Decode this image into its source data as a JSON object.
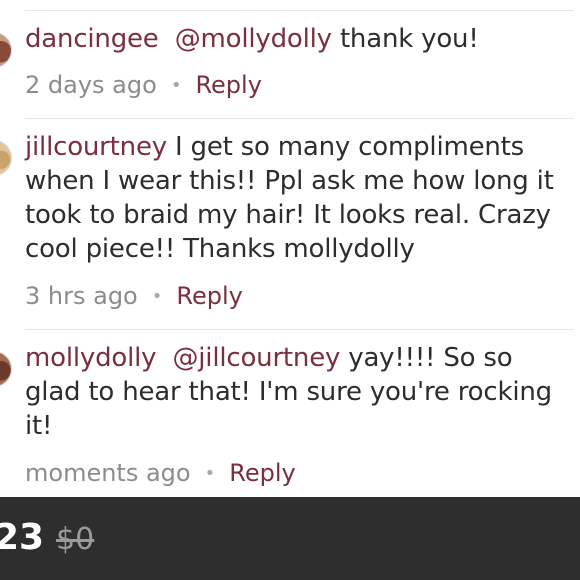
{
  "comments": [
    {
      "username": "dancingee",
      "mention": "@mollydolly",
      "text": " thank you!",
      "time": "2 days ago",
      "reply_label": "Reply"
    },
    {
      "username": "jillcourtney",
      "mention": "",
      "text": " I get so many compliments when I wear this!! Ppl ask me how long it took to braid my hair! It looks real. Crazy cool piece!! Thanks mollydolly",
      "time": "3 hrs ago",
      "reply_label": "Reply"
    },
    {
      "username": "mollydolly",
      "mention": "@jillcourtney",
      "text": " yay!!!! So so glad to hear that! I'm sure you're rocking it!",
      "time": "moments ago",
      "reply_label": "Reply"
    }
  ],
  "meta_separator": "•",
  "price_bar": {
    "price": "23",
    "original_price": "$0"
  },
  "colors": {
    "accent": "#7a2e3f",
    "text": "#2d2d2d",
    "muted": "#8c8c8c",
    "bar_background": "#2e2e2e"
  }
}
